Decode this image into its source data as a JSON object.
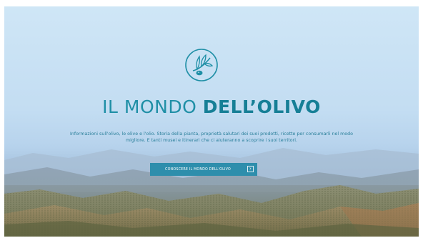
{
  "hero": {
    "title_light": "IL MONDO",
    "title_bold": "DELL’OLIVO",
    "description_line1": "Informazioni sull'olivo, le olive e l'olio. Storia della pianta, proprietà salutari dei suoi prodotti, ricette per consumarli nel modo",
    "description_line2": "migliore. E tanti musei e itinerari che ci aiuteranno a scoprire i suoi territori.",
    "cta_label": "CONOSCERE IL MONDO DELL'OLIVO",
    "cta_icon": "arrow-right-icon",
    "logo_icon": "olive-branch-icon"
  },
  "colors": {
    "brand": "#1f8fa6",
    "button": "#2e8eac",
    "sky_top": "#cfe6f6",
    "hills": "#77795d"
  }
}
